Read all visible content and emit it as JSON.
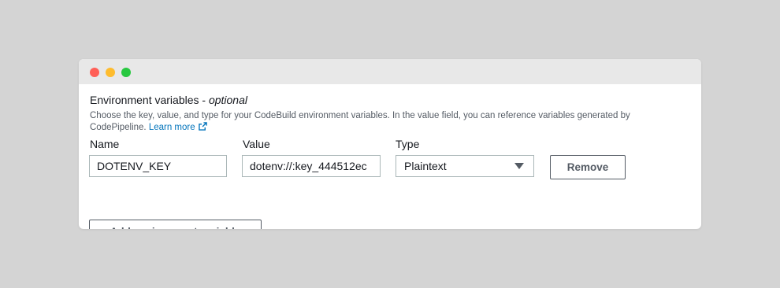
{
  "window": {
    "controls": [
      "close",
      "minimize",
      "maximize"
    ]
  },
  "section": {
    "title": "Environment variables - ",
    "title_optional": "optional",
    "description": "Choose the key, value, and type for your CodeBuild environment variables. In the value field, you can reference variables generated by CodePipeline.",
    "learn_more": "Learn more",
    "learn_more_icon": "external-link-icon"
  },
  "columns": {
    "name": "Name",
    "value": "Value",
    "type": "Type"
  },
  "variables": [
    {
      "name": "DOTENV_KEY",
      "value": "dotenv://:key_444512ec",
      "type": "Plaintext"
    }
  ],
  "buttons": {
    "remove": "Remove",
    "add": "Add environment variable"
  },
  "colors": {
    "link": "#0073bb",
    "text": "#16191f",
    "muted": "#545b64",
    "border": "#aab7b8"
  }
}
